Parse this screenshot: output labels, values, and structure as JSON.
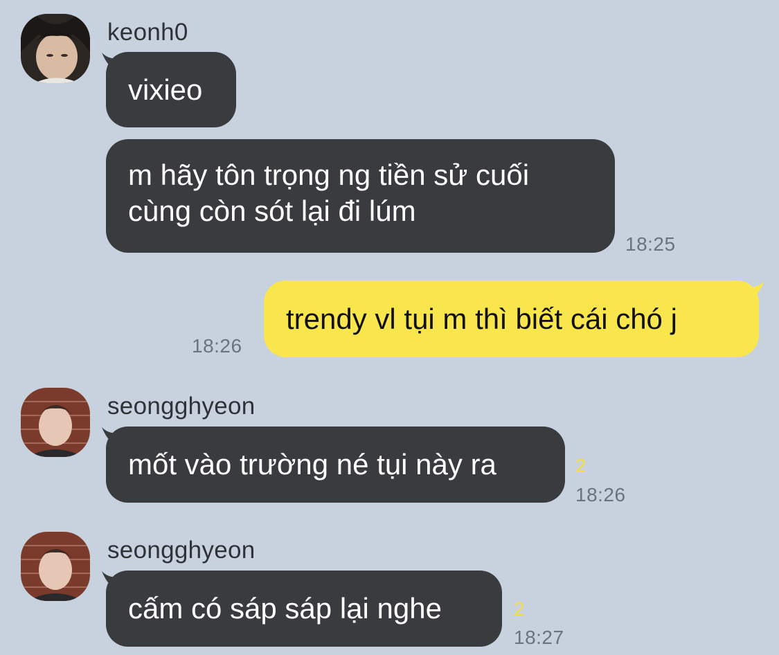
{
  "messages": [
    {
      "sender": "keonh0",
      "text": "vixieo",
      "time": ""
    },
    {
      "sender": "keonh0",
      "lines": [
        "m hãy tôn trọng ng tiền sử cuối",
        "cùng còn sót lại đi lúm"
      ],
      "time": "18:25"
    },
    {
      "sender": "me",
      "text": "trendy vl tụi m thì biết cái chó j",
      "time": "18:26"
    },
    {
      "sender": "seongghyeon",
      "text": "mốt vào trường né tụi này ra",
      "unread": "2",
      "time": "18:26"
    },
    {
      "sender": "seongghyeon",
      "text": "cấm có sáp sáp lại nghe",
      "unread": "2",
      "time": "18:27"
    }
  ],
  "colors": {
    "background": "#c7d2de",
    "incoming_bubble": "#3a3b3e",
    "outgoing_bubble": "#f9e64d",
    "unread_count": "#f4df43"
  }
}
